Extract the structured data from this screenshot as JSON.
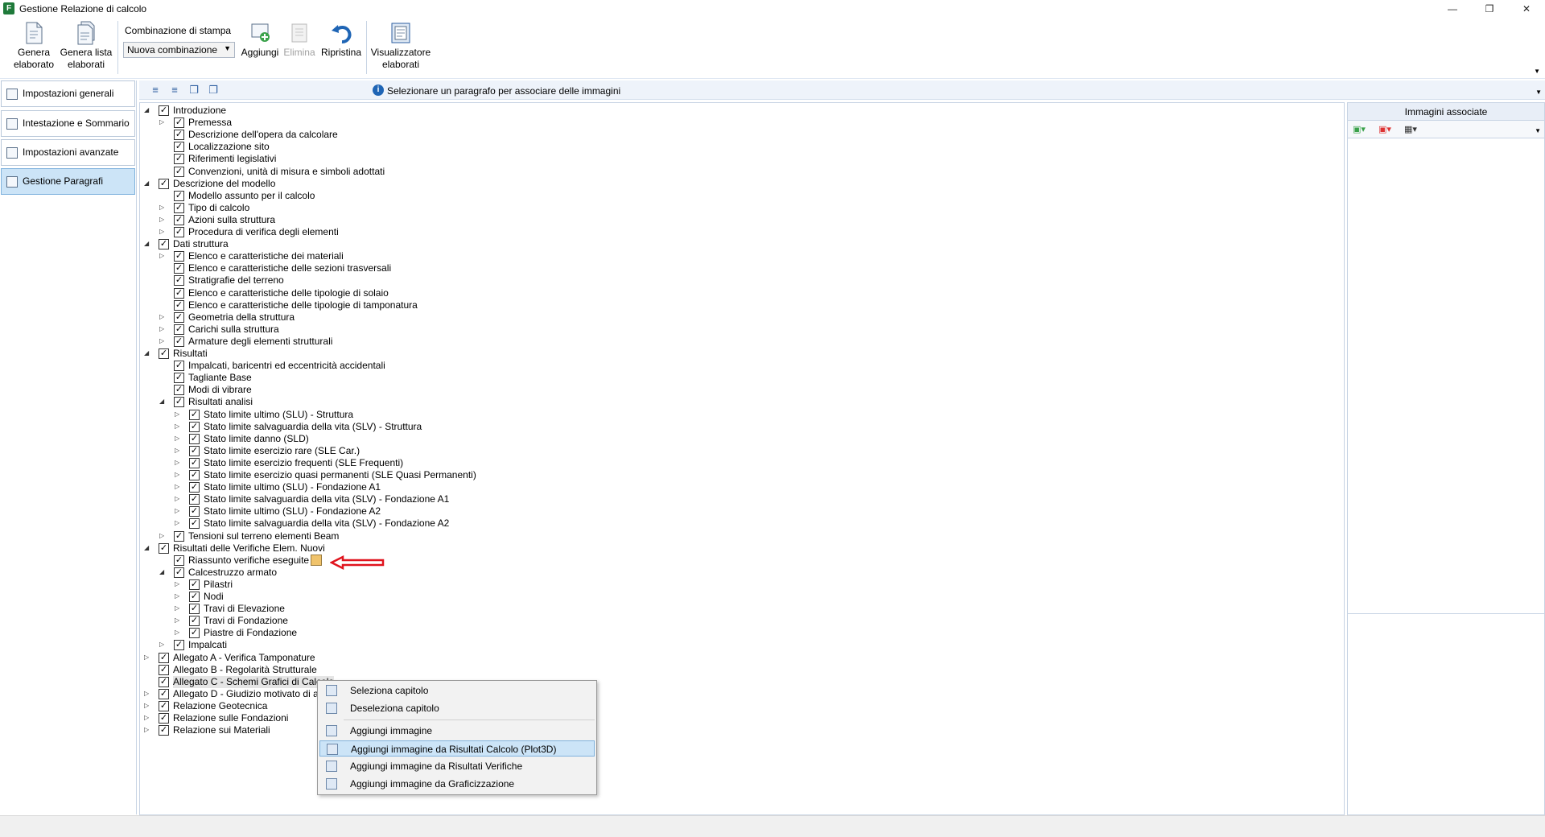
{
  "window": {
    "title": "Gestione Relazione di calcolo",
    "controls": [
      "—",
      "❐",
      "✕"
    ]
  },
  "ribbon": {
    "genera_elaborato": "Genera elaborato",
    "genera_lista": "Genera lista elaborati",
    "combo_label": "Combinazione di stampa",
    "combo_value": "Nuova combinazione",
    "aggiungi": "Aggiungi",
    "elimina": "Elimina",
    "ripristina": "Ripristina",
    "visualizzatore": "Visualizzatore elaborati"
  },
  "sidebar": {
    "items": [
      {
        "label": "Impostazioni generali"
      },
      {
        "label": "Intestazione e Sommario"
      },
      {
        "label": "Impostazioni avanzate"
      },
      {
        "label": "Gestione Paragrafi",
        "selected": true
      }
    ]
  },
  "toolstrip": {
    "info": "Selezionare un paragrafo per associare delle immagini"
  },
  "tree": {
    "rows": [
      {
        "level": 0,
        "exp": "open",
        "label": "Introduzione"
      },
      {
        "level": 1,
        "exp": "closed",
        "label": "Premessa"
      },
      {
        "level": 1,
        "exp": "none",
        "label": "Descrizione dell'opera da calcolare"
      },
      {
        "level": 1,
        "exp": "none",
        "label": "Localizzazione sito"
      },
      {
        "level": 1,
        "exp": "none",
        "label": "Riferimenti legislativi"
      },
      {
        "level": 1,
        "exp": "none",
        "label": "Convenzioni, unità di misura e simboli adottati"
      },
      {
        "level": 0,
        "exp": "open",
        "label": "Descrizione del modello"
      },
      {
        "level": 1,
        "exp": "none",
        "label": "Modello assunto per il calcolo"
      },
      {
        "level": 1,
        "exp": "closed",
        "label": "Tipo di calcolo"
      },
      {
        "level": 1,
        "exp": "closed",
        "label": "Azioni sulla struttura"
      },
      {
        "level": 1,
        "exp": "closed",
        "label": "Procedura di verifica degli elementi"
      },
      {
        "level": 0,
        "exp": "open",
        "label": "Dati struttura"
      },
      {
        "level": 1,
        "exp": "closed",
        "label": "Elenco e caratteristiche dei materiali"
      },
      {
        "level": 1,
        "exp": "none",
        "label": "Elenco e caratteristiche delle sezioni trasversali"
      },
      {
        "level": 1,
        "exp": "none",
        "label": "Stratigrafie del terreno"
      },
      {
        "level": 1,
        "exp": "none",
        "label": "Elenco e caratteristiche delle tipologie di solaio"
      },
      {
        "level": 1,
        "exp": "none",
        "label": "Elenco e caratteristiche delle tipologie di tamponatura"
      },
      {
        "level": 1,
        "exp": "closed",
        "label": "Geometria della struttura"
      },
      {
        "level": 1,
        "exp": "closed",
        "label": "Carichi sulla struttura"
      },
      {
        "level": 1,
        "exp": "closed",
        "label": "Armature degli elementi strutturali"
      },
      {
        "level": 0,
        "exp": "open",
        "label": "Risultati"
      },
      {
        "level": 1,
        "exp": "none",
        "label": "Impalcati, baricentri ed eccentricità accidentali"
      },
      {
        "level": 1,
        "exp": "none",
        "label": "Tagliante Base"
      },
      {
        "level": 1,
        "exp": "none",
        "label": "Modi di vibrare"
      },
      {
        "level": 1,
        "exp": "open",
        "label": "Risultati analisi"
      },
      {
        "level": 2,
        "exp": "closed",
        "label": "Stato limite ultimo (SLU) - Struttura"
      },
      {
        "level": 2,
        "exp": "closed",
        "label": "Stato limite salvaguardia della vita (SLV) - Struttura"
      },
      {
        "level": 2,
        "exp": "closed",
        "label": "Stato limite danno (SLD)"
      },
      {
        "level": 2,
        "exp": "closed",
        "label": "Stato limite esercizio rare (SLE Car.)"
      },
      {
        "level": 2,
        "exp": "closed",
        "label": "Stato limite esercizio frequenti (SLE Frequenti)"
      },
      {
        "level": 2,
        "exp": "closed",
        "label": "Stato limite esercizio quasi permanenti (SLE Quasi Permanenti)"
      },
      {
        "level": 2,
        "exp": "closed",
        "label": "Stato limite ultimo (SLU) - Fondazione A1"
      },
      {
        "level": 2,
        "exp": "closed",
        "label": "Stato limite salvaguardia della vita (SLV) - Fondazione A1"
      },
      {
        "level": 2,
        "exp": "closed",
        "label": "Stato limite ultimo (SLU) - Fondazione A2"
      },
      {
        "level": 2,
        "exp": "closed",
        "label": "Stato limite salvaguardia della vita (SLV) - Fondazione A2"
      },
      {
        "level": 1,
        "exp": "closed",
        "label": "Tensioni sul terreno elementi Beam"
      },
      {
        "level": 0,
        "exp": "open",
        "label": "Risultati delle Verifiche Elem. Nuovi"
      },
      {
        "level": 1,
        "exp": "none",
        "label": "Riassunto verifiche eseguite"
      },
      {
        "level": 1,
        "exp": "open",
        "label": "Calcestruzzo armato"
      },
      {
        "level": 2,
        "exp": "closed",
        "label": "Pilastri"
      },
      {
        "level": 2,
        "exp": "closed",
        "label": "Nodi"
      },
      {
        "level": 2,
        "exp": "closed",
        "label": "Travi di Elevazione"
      },
      {
        "level": 2,
        "exp": "closed",
        "label": "Travi di Fondazione"
      },
      {
        "level": 2,
        "exp": "closed",
        "label": "Piastre di Fondazione"
      },
      {
        "level": 1,
        "exp": "closed",
        "label": "Impalcati"
      },
      {
        "level": 0,
        "exp": "closed",
        "label": "Allegato A - Verifica Tamponature"
      },
      {
        "level": 0,
        "exp": "none",
        "label": "Allegato B - Regolarità Strutturale"
      },
      {
        "level": 0,
        "exp": "none",
        "label": "Allegato C - Schemi Grafici di Calcolo"
      },
      {
        "level": 0,
        "exp": "closed",
        "label": "Allegato D - Giudizio motivato di a"
      },
      {
        "level": 0,
        "exp": "closed",
        "label": "Relazione Geotecnica"
      },
      {
        "level": 0,
        "exp": "closed",
        "label": "Relazione sulle Fondazioni"
      },
      {
        "level": 0,
        "exp": "closed",
        "label": "Relazione sui Materiali"
      }
    ]
  },
  "right_panel": {
    "header": "Immagini associate"
  },
  "context_menu": {
    "items": [
      {
        "label": "Seleziona capitolo"
      },
      {
        "label": "Deseleziona capitolo"
      },
      {
        "label": "Aggiungi immagine"
      },
      {
        "label": "Aggiungi immagine da Risultati Calcolo (Plot3D)",
        "highlighted": true
      },
      {
        "label": "Aggiungi immagine da Risultati Verifiche"
      },
      {
        "label": "Aggiungi immagine da Graficizzazione"
      }
    ]
  },
  "colors": {
    "accent": "#1f65b5",
    "selection": "#cce4f7",
    "annotation_arrow": "#e0141e"
  }
}
